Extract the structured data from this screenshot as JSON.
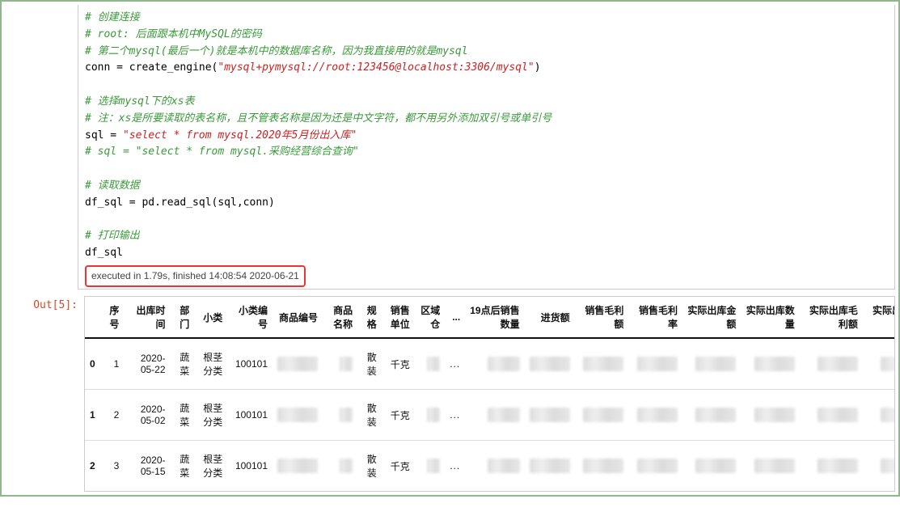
{
  "code_lines": [
    {
      "type": "comment",
      "t": "# 创建连接"
    },
    {
      "type": "comment",
      "t": "# root: 后面跟本机中MySQL的密码"
    },
    {
      "type": "comment",
      "t": "# 第二个mysql(最后一个)就是本机中的数据库名称，因为我直接用的就是mysql"
    },
    {
      "type": "assign",
      "lhs": "conn",
      "func": "create_engine",
      "arg": "\"mysql+pymysql://root:123456@localhost:3306/mysql\""
    },
    {
      "type": "blank",
      "t": ""
    },
    {
      "type": "comment",
      "t": "# 选择mysql下的xs表"
    },
    {
      "type": "comment",
      "t": "# 注：xs是所要读取的表名称，且不管表名称是因为还是中文字符，都不用另外添加双引号或单引号"
    },
    {
      "type": "assign",
      "lhs": "sql",
      "arg": "\"select * from mysql.2020年5月份出入库\""
    },
    {
      "type": "comment",
      "t": "# sql = \"select * from mysql.采购经营综合查询\""
    },
    {
      "type": "blank",
      "t": ""
    },
    {
      "type": "comment",
      "t": "# 读取数据"
    },
    {
      "type": "plain",
      "t": "df_sql = pd.read_sql(sql,conn)"
    },
    {
      "type": "blank",
      "t": ""
    },
    {
      "type": "comment",
      "t": "# 打印输出"
    },
    {
      "type": "plain",
      "t": "df_sql"
    }
  ],
  "exec_status": "executed in 1.79s, finished 14:08:54 2020-06-21",
  "out_label": "Out[5]:",
  "table": {
    "headers": [
      "",
      "序号",
      "出库时间",
      "部门",
      "小类",
      "小类编号",
      "商品编号",
      "商品名称",
      "规格",
      "销售单位",
      "区域仓",
      "...",
      "19点后销售数量",
      "进货额",
      "销售毛利额",
      "销售毛利率",
      "实际出库金额",
      "实际出库数量",
      "实际出库毛利额",
      "实际出库毛利率"
    ],
    "rows": [
      {
        "idx": "0",
        "seq": "1",
        "date": "2020-05-22",
        "dept": "蔬菜",
        "cat": "根茎分类",
        "catno": "100101",
        "unit1": "散装",
        "unit2": "千克"
      },
      {
        "idx": "1",
        "seq": "2",
        "date": "2020-05-02",
        "dept": "蔬菜",
        "cat": "根茎分类",
        "catno": "100101",
        "unit1": "散装",
        "unit2": "千克"
      },
      {
        "idx": "2",
        "seq": "3",
        "date": "2020-05-15",
        "dept": "蔬菜",
        "cat": "根茎分类",
        "catno": "100101",
        "unit1": "散装",
        "unit2": "千克"
      }
    ],
    "ellipsis": "..."
  }
}
